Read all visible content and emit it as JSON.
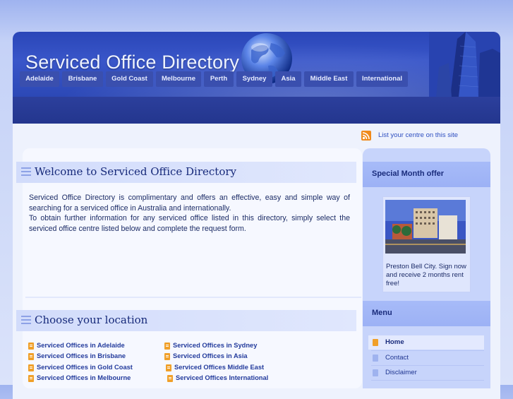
{
  "header": {
    "site_title": "Serviced Office Directory"
  },
  "nav": {
    "items": [
      "Adelaide",
      "Brisbane",
      "Gold Coast",
      "Melbourne",
      "Perth",
      "Sydney",
      "Asia",
      "Middle East",
      "International"
    ]
  },
  "rss": {
    "link_text": "List your centre on this site"
  },
  "welcome": {
    "title": "Welcome to Serviced Office Directory",
    "paragraph1": "Serviced Office Directory is complimentary and offers an effective, easy and simple way of searching for a serviced office in Australia and internationally.",
    "paragraph2": "To obtain further information for any serviced office listed in this directory, simply select the serviced office centre listed below and complete the request form."
  },
  "locations": {
    "title": "Choose your location",
    "left": [
      "Serviced Offices in Adelaide",
      "Serviced Offices in Brisbane",
      "Serviced Offices in Gold Coast",
      "Serviced Offices in Melbourne"
    ],
    "right": [
      "Serviced Offices in Sydney",
      "Serviced Offices in Asia",
      "Serviced Offices Middle East",
      "Serviced Offices International"
    ]
  },
  "sidebar": {
    "offer_title": "Special Month offer",
    "offer_text": "Preston Bell City. Sign now and receive 2 months rent free!",
    "menu_title": "Menu",
    "menu_items": [
      "Home",
      "Contact",
      "Disclaimer"
    ]
  },
  "colors": {
    "header_blue": "#2a46b8",
    "nav_bg": "#3a4fae",
    "bullet_orange": "#f0a02a",
    "link_blue": "#233b9c"
  }
}
